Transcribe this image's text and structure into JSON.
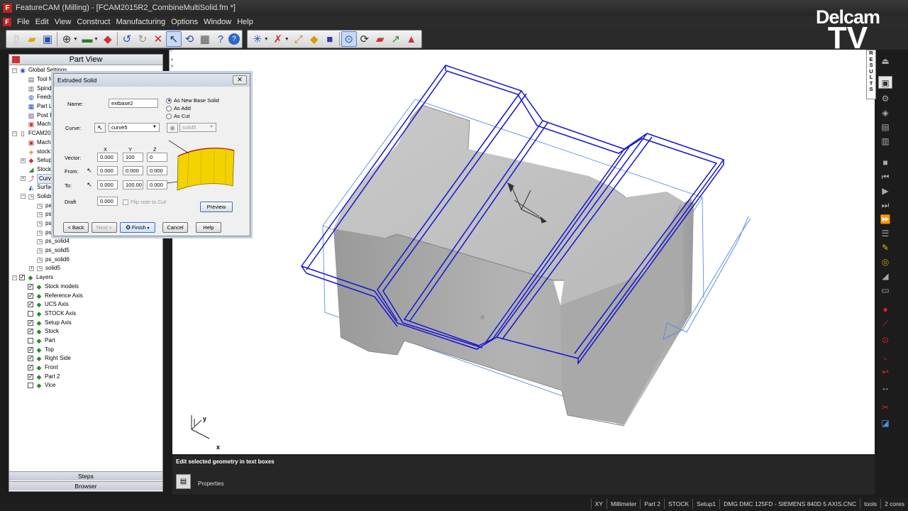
{
  "window": {
    "title": "FeatureCAM (Milling) - [FCAM2015R2_CombineMultiSolid.fm *]"
  },
  "logo": {
    "line1": "Delcam",
    "line2": "TV"
  },
  "menu": {
    "items": [
      "File",
      "Edit",
      "View",
      "Construct",
      "Manufacturing",
      "Options",
      "Window",
      "Help"
    ]
  },
  "part_view": {
    "title": "Part View",
    "tree": [
      {
        "label": "Global Settings",
        "level": 0,
        "exp": "minus",
        "icon": "globe-icon"
      },
      {
        "label": "Tool Man",
        "level": 1,
        "icon": "tool-icon"
      },
      {
        "label": "Spindles",
        "level": 1,
        "icon": "spindle-icon"
      },
      {
        "label": "Feeds S",
        "level": 1,
        "icon": "feeds-icon"
      },
      {
        "label": "Part Libra",
        "level": 1,
        "icon": "library-icon"
      },
      {
        "label": "Post Proc",
        "level": 1,
        "icon": "post-icon"
      },
      {
        "label": "Machinin",
        "level": 1,
        "icon": "machine-icon"
      },
      {
        "label": "FCAM2015R",
        "level": 0,
        "exp": "minus",
        "icon": "document-icon"
      },
      {
        "label": "Machinin",
        "level": 1,
        "icon": "machine-icon"
      },
      {
        "label": "stock1",
        "level": 1,
        "icon": "stock-icon"
      },
      {
        "label": "Setup1",
        "level": 1,
        "exp": "plus",
        "icon": "setup-icon"
      },
      {
        "label": "Stock Mo",
        "level": 1,
        "icon": "stock-model-icon"
      },
      {
        "label": "Curves",
        "level": 1,
        "exp": "plus",
        "icon": "curve-icon",
        "selected": true
      },
      {
        "label": "Surfaces",
        "level": 1,
        "icon": "surface-icon"
      },
      {
        "label": "Solids",
        "level": 1,
        "exp": "minus",
        "icon": "solid-icon"
      },
      {
        "label": "part",
        "level": 2,
        "icon": "solid-icon"
      },
      {
        "label": "ps_s",
        "level": 2,
        "icon": "solid-icon"
      },
      {
        "label": "ps_s",
        "level": 2,
        "icon": "solid-icon"
      },
      {
        "label": "ps_s",
        "level": 2,
        "icon": "solid-icon"
      },
      {
        "label": "ps_solid4",
        "level": 2,
        "icon": "solid-icon"
      },
      {
        "label": "ps_solid5",
        "level": 2,
        "icon": "solid-icon"
      },
      {
        "label": "ps_solid6",
        "level": 2,
        "icon": "solid-icon"
      },
      {
        "label": "solid5",
        "level": 2,
        "exp": "plus",
        "icon": "solid-icon"
      },
      {
        "label": "Layers",
        "level": 0,
        "exp": "minus",
        "check": "on",
        "icon": "layers-icon"
      },
      {
        "label": "Stock models",
        "level": 1,
        "check": "on",
        "icon": "layer-icon"
      },
      {
        "label": "Reference Axis",
        "level": 1,
        "check": "on",
        "icon": "layer-icon"
      },
      {
        "label": "UCS Axis",
        "level": 1,
        "check": "on",
        "icon": "layer-icon"
      },
      {
        "label": "STOCK Axis",
        "level": 1,
        "check": "off",
        "icon": "layer-icon"
      },
      {
        "label": "Setup Axis",
        "level": 1,
        "check": "on",
        "icon": "layer-icon"
      },
      {
        "label": "Stock",
        "level": 1,
        "check": "on",
        "icon": "layer-icon"
      },
      {
        "label": "Part",
        "level": 1,
        "check": "off",
        "icon": "layer-icon"
      },
      {
        "label": "Top",
        "level": 1,
        "check": "on",
        "icon": "layer-icon"
      },
      {
        "label": "Right Side",
        "level": 1,
        "check": "on",
        "icon": "layer-icon"
      },
      {
        "label": "Front",
        "level": 1,
        "check": "on",
        "icon": "layer-icon"
      },
      {
        "label": "Part 2",
        "level": 1,
        "check": "on",
        "icon": "layer-icon"
      },
      {
        "label": "Vice",
        "level": 1,
        "check": "off",
        "icon": "layer-icon"
      }
    ],
    "tabs": [
      "Steps",
      "Browser"
    ]
  },
  "side_tabs": {
    "tools": "TOOLS",
    "results": "RESULTS"
  },
  "dialog": {
    "title": "Extruded Solid",
    "close": "✕",
    "name_label": "Name:",
    "name_value": "extbase2",
    "options": [
      {
        "label": "As New Base Solid",
        "selected": true
      },
      {
        "label": "As Add",
        "selected": false
      },
      {
        "label": "As Cut",
        "selected": false
      }
    ],
    "curve_label": "Curve:",
    "curve_value": "curve5",
    "solid_value": "solid5",
    "col_headers": [
      "X",
      "Y",
      "Z"
    ],
    "vector_label": "Vector:",
    "vector": [
      "0.000",
      "100",
      "0"
    ],
    "from_label": "From:",
    "from": [
      "0.000",
      "0.000",
      "0.000"
    ],
    "to_label": "To:",
    "to": [
      "0.000",
      "100.00",
      "0.000"
    ],
    "draft_label": "Draft",
    "draft_value": "0.000",
    "flip_label": "Flip side to Cut",
    "preview": "Preview",
    "buttons": {
      "back": "< Back",
      "next": "Next >",
      "finish": "Finish",
      "cancel": "Cancel",
      "help": "Help"
    }
  },
  "viewport": {
    "axis_y": "y",
    "axis_x": "x"
  },
  "message": {
    "text": "Edit selected geometry in text boxes",
    "properties": "Properties"
  },
  "status": [
    "XY",
    "Millimeter",
    "Part 2",
    "STOCK",
    "Setup1",
    "DMG DMC 125FD - SIEMENS 840D 5 AXIS.CNC",
    "tools",
    "2 cores"
  ],
  "colors": {
    "selection_blue": "#1414d2",
    "stock_outline": "#5a8ee8",
    "part_gray": "#b4b4b4",
    "preview_yellow": "#f2d200"
  }
}
